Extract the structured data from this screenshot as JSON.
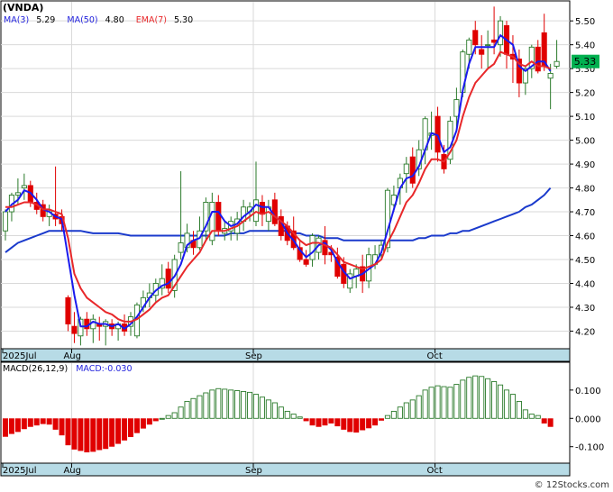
{
  "title": "(VNDA)",
  "indicators": {
    "ma3": {
      "label": "MA(3)",
      "value": "5.29",
      "color": "#2222dd"
    },
    "ma50": {
      "label": "MA(50)",
      "value": "4.80",
      "color": "#2222dd"
    },
    "ema7": {
      "label": "EMA(7)",
      "value": "5.30",
      "color": "#e8282a"
    }
  },
  "last_price": "5.33",
  "macd_legend": {
    "params": "MACD(26,12,9)",
    "value_text": "MACD:-0.030"
  },
  "footer": "© 12Stocks.com",
  "colors": {
    "up": "#2a7a2a",
    "down": "#e00000",
    "ma_blue": "#1a1aee",
    "ema_red": "#e8282a",
    "ma50_blue": "#1a3acc",
    "axis_band": "#b7dbe6",
    "price_tag": "#00b050"
  },
  "chart_data": [
    {
      "type": "candlestick",
      "title": "",
      "ylim": [
        4.13,
        5.58
      ],
      "y_ticks": [
        4.2,
        4.3,
        4.4,
        4.5,
        4.6,
        4.7,
        4.8,
        4.9,
        5.0,
        5.1,
        5.2,
        5.3,
        5.4,
        5.5
      ],
      "y_tick_labels": [
        "4.20",
        "4.30",
        "4.40",
        "4.50",
        "4.60",
        "4.70",
        "4.80",
        "4.90",
        "5.00",
        "5.10",
        "5.20",
        "5.30",
        "5.40",
        "5.50"
      ],
      "x_labels": [
        {
          "label": "2025Jul",
          "index": 0
        },
        {
          "label": "Aug",
          "index": 11
        },
        {
          "label": "Sep",
          "index": 40
        },
        {
          "label": "Oct",
          "index": 69
        }
      ],
      "n_bars": 88,
      "ohlc": [
        [
          4.62,
          4.71,
          4.58,
          4.7
        ],
        [
          4.7,
          4.78,
          4.66,
          4.77
        ],
        [
          4.77,
          4.84,
          4.73,
          4.78
        ],
        [
          4.8,
          4.86,
          4.75,
          4.81
        ],
        [
          4.81,
          4.83,
          4.72,
          4.74
        ],
        [
          4.74,
          4.78,
          4.69,
          4.71
        ],
        [
          4.73,
          4.75,
          4.66,
          4.68
        ],
        [
          4.68,
          4.73,
          4.64,
          4.7
        ],
        [
          4.69,
          4.89,
          4.64,
          4.67
        ],
        [
          4.68,
          4.71,
          4.62,
          4.65
        ],
        [
          4.34,
          4.35,
          4.2,
          4.23
        ],
        [
          4.22,
          4.28,
          4.15,
          4.19
        ],
        [
          4.18,
          4.26,
          4.14,
          4.25
        ],
        [
          4.25,
          4.28,
          4.18,
          4.21
        ],
        [
          4.21,
          4.27,
          4.15,
          4.25
        ],
        [
          4.23,
          4.26,
          4.16,
          4.22
        ],
        [
          4.22,
          4.25,
          4.14,
          4.24
        ],
        [
          4.23,
          4.25,
          4.18,
          4.21
        ],
        [
          4.21,
          4.24,
          4.16,
          4.23
        ],
        [
          4.23,
          4.27,
          4.18,
          4.2
        ],
        [
          4.22,
          4.28,
          4.18,
          4.26
        ],
        [
          4.18,
          4.32,
          4.17,
          4.31
        ],
        [
          4.3,
          4.37,
          4.28,
          4.34
        ],
        [
          4.34,
          4.4,
          4.3,
          4.36
        ],
        [
          4.35,
          4.42,
          4.32,
          4.4
        ],
        [
          4.38,
          4.48,
          4.35,
          4.42
        ],
        [
          4.46,
          4.49,
          4.36,
          4.38
        ],
        [
          4.37,
          4.52,
          4.34,
          4.5
        ],
        [
          4.53,
          4.87,
          4.5,
          4.57
        ],
        [
          4.55,
          4.65,
          4.53,
          4.61
        ],
        [
          4.58,
          4.62,
          4.52,
          4.55
        ],
        [
          4.55,
          4.68,
          4.54,
          4.62
        ],
        [
          4.62,
          4.76,
          4.58,
          4.74
        ],
        [
          4.58,
          4.78,
          4.56,
          4.74
        ],
        [
          4.74,
          4.77,
          4.6,
          4.62
        ],
        [
          4.61,
          4.66,
          4.58,
          4.63
        ],
        [
          4.62,
          4.68,
          4.58,
          4.66
        ],
        [
          4.61,
          4.7,
          4.58,
          4.67
        ],
        [
          4.66,
          4.75,
          4.62,
          4.72
        ],
        [
          4.7,
          4.74,
          4.66,
          4.72
        ],
        [
          4.66,
          4.91,
          4.64,
          4.75
        ],
        [
          4.74,
          4.77,
          4.64,
          4.69
        ],
        [
          4.66,
          4.75,
          4.62,
          4.72
        ],
        [
          4.75,
          4.78,
          4.64,
          4.65
        ],
        [
          4.68,
          4.71,
          4.58,
          4.6
        ],
        [
          4.64,
          4.66,
          4.56,
          4.58
        ],
        [
          4.62,
          4.68,
          4.54,
          4.55
        ],
        [
          4.55,
          4.58,
          4.49,
          4.5
        ],
        [
          4.5,
          4.54,
          4.47,
          4.48
        ],
        [
          4.5,
          4.61,
          4.47,
          4.6
        ],
        [
          4.53,
          4.6,
          4.5,
          4.59
        ],
        [
          4.58,
          4.64,
          4.48,
          4.52
        ],
        [
          4.53,
          4.56,
          4.49,
          4.52
        ],
        [
          4.51,
          4.55,
          4.42,
          4.43
        ],
        [
          4.48,
          4.51,
          4.38,
          4.4
        ],
        [
          4.38,
          4.46,
          4.36,
          4.44
        ],
        [
          4.43,
          4.48,
          4.38,
          4.46
        ],
        [
          4.47,
          4.52,
          4.36,
          4.41
        ],
        [
          4.41,
          4.55,
          4.38,
          4.52
        ],
        [
          4.48,
          4.56,
          4.46,
          4.52
        ],
        [
          4.52,
          4.58,
          4.5,
          4.56
        ],
        [
          4.55,
          4.8,
          4.53,
          4.79
        ],
        [
          4.73,
          4.81,
          4.7,
          4.77
        ],
        [
          4.8,
          4.86,
          4.73,
          4.84
        ],
        [
          4.86,
          4.93,
          4.78,
          4.9
        ],
        [
          4.93,
          4.97,
          4.8,
          4.82
        ],
        [
          4.88,
          5.0,
          4.85,
          4.96
        ],
        [
          4.96,
          5.1,
          4.9,
          5.09
        ],
        [
          5.02,
          5.12,
          4.96,
          5.03
        ],
        [
          5.1,
          5.14,
          4.91,
          4.95
        ],
        [
          4.94,
          4.98,
          4.86,
          4.88
        ],
        [
          4.92,
          5.1,
          4.9,
          5.08
        ],
        [
          5.1,
          5.22,
          5.05,
          5.17
        ],
        [
          5.2,
          5.38,
          5.18,
          5.37
        ],
        [
          5.36,
          5.43,
          5.3,
          5.42
        ],
        [
          5.46,
          5.5,
          5.36,
          5.4
        ],
        [
          5.38,
          5.44,
          5.3,
          5.36
        ],
        [
          5.4,
          5.46,
          5.3,
          5.4
        ],
        [
          5.42,
          5.56,
          5.36,
          5.41
        ],
        [
          5.4,
          5.52,
          5.35,
          5.5
        ],
        [
          5.48,
          5.5,
          5.3,
          5.36
        ],
        [
          5.36,
          5.44,
          5.24,
          5.34
        ],
        [
          5.34,
          5.38,
          5.18,
          5.24
        ],
        [
          5.24,
          5.31,
          5.19,
          5.3
        ],
        [
          5.3,
          5.4,
          5.26,
          5.39
        ],
        [
          5.39,
          5.42,
          5.28,
          5.29
        ],
        [
          5.45,
          5.53,
          5.29,
          5.31
        ],
        [
          5.26,
          5.32,
          5.13,
          5.28
        ],
        [
          5.31,
          5.42,
          5.3,
          5.33
        ]
      ],
      "ma3": [
        4.7,
        4.73,
        4.75,
        4.79,
        4.78,
        4.75,
        4.71,
        4.7,
        4.68,
        4.67,
        4.51,
        4.35,
        4.22,
        4.22,
        4.24,
        4.23,
        4.23,
        4.22,
        4.23,
        4.21,
        4.23,
        4.26,
        4.3,
        4.34,
        4.37,
        4.39,
        4.4,
        4.43,
        4.48,
        4.56,
        4.58,
        4.59,
        4.64,
        4.7,
        4.7,
        4.66,
        4.64,
        4.65,
        4.68,
        4.7,
        4.73,
        4.72,
        4.72,
        4.68,
        4.66,
        4.61,
        4.58,
        4.54,
        4.51,
        4.53,
        4.56,
        4.57,
        4.54,
        4.49,
        4.45,
        4.42,
        4.43,
        4.44,
        4.46,
        4.48,
        4.53,
        4.62,
        4.71,
        4.8,
        4.84,
        4.85,
        4.89,
        4.96,
        5.03,
        5.02,
        4.95,
        4.97,
        5.04,
        5.21,
        5.32,
        5.39,
        5.39,
        5.39,
        5.39,
        5.44,
        5.42,
        5.4,
        5.31,
        5.29,
        5.31,
        5.33,
        5.33,
        5.29
      ],
      "ma50": [
        4.53,
        4.55,
        4.57,
        4.58,
        4.59,
        4.6,
        4.61,
        4.62,
        4.62,
        4.62,
        4.62,
        4.62,
        4.62,
        4.615,
        4.61,
        4.61,
        4.61,
        4.61,
        4.61,
        4.605,
        4.6,
        4.6,
        4.6,
        4.6,
        4.6,
        4.6,
        4.6,
        4.6,
        4.6,
        4.6,
        4.6,
        4.6,
        4.6,
        4.6,
        4.6,
        4.6,
        4.61,
        4.61,
        4.61,
        4.62,
        4.62,
        4.62,
        4.62,
        4.62,
        4.62,
        4.62,
        4.61,
        4.61,
        4.6,
        4.6,
        4.6,
        4.59,
        4.59,
        4.59,
        4.58,
        4.58,
        4.58,
        4.58,
        4.58,
        4.58,
        4.58,
        4.58,
        4.58,
        4.58,
        4.58,
        4.58,
        4.59,
        4.59,
        4.6,
        4.6,
        4.6,
        4.61,
        4.61,
        4.62,
        4.62,
        4.63,
        4.64,
        4.65,
        4.66,
        4.67,
        4.68,
        4.69,
        4.7,
        4.72,
        4.73,
        4.75,
        4.77,
        4.8
      ],
      "ema7": [
        4.72,
        4.72,
        4.73,
        4.74,
        4.74,
        4.73,
        4.71,
        4.71,
        4.7,
        4.69,
        4.59,
        4.44,
        4.38,
        4.34,
        4.32,
        4.3,
        4.28,
        4.27,
        4.25,
        4.24,
        4.24,
        4.25,
        4.27,
        4.29,
        4.32,
        4.34,
        4.35,
        4.39,
        4.43,
        4.47,
        4.5,
        4.53,
        4.58,
        4.62,
        4.62,
        4.62,
        4.63,
        4.64,
        4.66,
        4.68,
        4.7,
        4.69,
        4.7,
        4.68,
        4.66,
        4.64,
        4.61,
        4.58,
        4.56,
        4.57,
        4.57,
        4.56,
        4.55,
        4.52,
        4.49,
        4.48,
        4.47,
        4.46,
        4.47,
        4.48,
        4.5,
        4.57,
        4.62,
        4.68,
        4.74,
        4.77,
        4.82,
        4.88,
        4.92,
        4.92,
        4.91,
        4.95,
        5.0,
        5.1,
        5.18,
        5.24,
        5.27,
        5.3,
        5.32,
        5.37,
        5.36,
        5.35,
        5.32,
        5.31,
        5.33,
        5.31,
        5.31,
        5.3
      ]
    },
    {
      "type": "bar",
      "title": "",
      "ylim": [
        -0.155,
        0.195
      ],
      "y_ticks": [
        0.1,
        0.0,
        -0.1
      ],
      "y_tick_labels": [
        "0.100",
        "0.000",
        "-0.100"
      ],
      "values": [
        -0.065,
        -0.055,
        -0.048,
        -0.038,
        -0.03,
        -0.025,
        -0.02,
        -0.022,
        -0.04,
        -0.06,
        -0.095,
        -0.11,
        -0.115,
        -0.12,
        -0.118,
        -0.112,
        -0.108,
        -0.1,
        -0.09,
        -0.078,
        -0.066,
        -0.052,
        -0.036,
        -0.022,
        -0.01,
        0.0,
        0.01,
        0.02,
        0.04,
        0.06,
        0.07,
        0.08,
        0.09,
        0.1,
        0.105,
        0.103,
        0.1,
        0.098,
        0.095,
        0.092,
        0.085,
        0.075,
        0.065,
        0.055,
        0.04,
        0.025,
        0.015,
        0.005,
        -0.01,
        -0.025,
        -0.03,
        -0.025,
        -0.018,
        -0.028,
        -0.04,
        -0.048,
        -0.05,
        -0.042,
        -0.035,
        -0.025,
        -0.008,
        0.01,
        0.025,
        0.04,
        0.055,
        0.065,
        0.08,
        0.1,
        0.11,
        0.115,
        0.112,
        0.11,
        0.12,
        0.135,
        0.145,
        0.15,
        0.148,
        0.14,
        0.13,
        0.118,
        0.1,
        0.085,
        0.06,
        0.03,
        0.015,
        0.01,
        -0.018,
        -0.03
      ]
    }
  ]
}
